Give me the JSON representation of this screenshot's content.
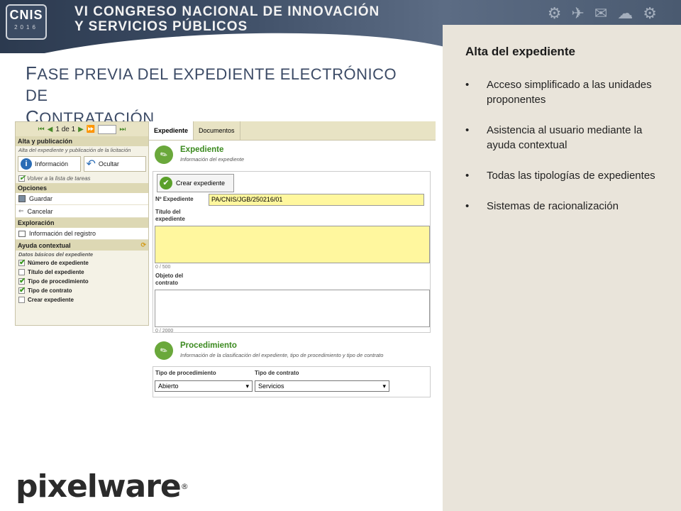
{
  "banner": {
    "logo_main": "CNIS",
    "logo_year": "2016",
    "title_line1": "VI CONGRESO NACIONAL DE INNOVACIÓN",
    "title_line2": "Y SERVICIOS PÚBLICOS"
  },
  "slide": {
    "title_f": "F",
    "title_rest1": "ASE PREVIA DEL EXPEDIENTE ELECTRÓNICO DE",
    "title_c": "C",
    "title_rest2": "ONTRATACIÓN"
  },
  "side": {
    "title": "Alta del expediente",
    "items": [
      "Acceso simplificado a las unidades proponentes",
      "Asistencia al usuario mediante la ayuda contextual",
      "Todas las tipologías de expedientes",
      "Sistemas de racionalización"
    ]
  },
  "app": {
    "pager": {
      "text": "1 de 1"
    },
    "left": {
      "section_title": "Alta y publicación",
      "section_sub": "Alta del expediente y publicación de la licitación",
      "info_btn": "Información",
      "hide_btn": "Ocultar",
      "back_link": "Volver a la lista de tareas",
      "options_head": "Opciones",
      "save": "Guardar",
      "cancel": "Cancelar",
      "explore_head": "Exploración",
      "record_info": "Información del registro",
      "help_head": "Ayuda contextual",
      "help_sub": "Datos básicos del expediente",
      "checklist": [
        {
          "label": "Número de expediente",
          "checked": true
        },
        {
          "label": "Título del expediente",
          "checked": false
        },
        {
          "label": "Tipo de procedimiento",
          "checked": true
        },
        {
          "label": "Tipo de contrato",
          "checked": true
        },
        {
          "label": "Crear expediente",
          "checked": false
        }
      ]
    },
    "tabs": [
      "Expediente",
      "Documentos"
    ],
    "expediente": {
      "title": "Expediente",
      "sub": "Información del expediente",
      "create_btn": "Crear expediente",
      "num_label": "Nº Expediente",
      "num_value": "PA/CNIS/JGB/250216/01",
      "title_label1": "Título del",
      "title_label2": "expediente",
      "title_count": "0 / 500",
      "object_label1": "Objeto del",
      "object_label2": "contrato",
      "object_count": "0 / 2000"
    },
    "procedimiento": {
      "title": "Procedimiento",
      "sub": "Información de la clasificación del expediente, tipo de procedimiento y tipo de contrato",
      "proc_label": "Tipo de procedimiento",
      "proc_value": "Abierto",
      "contract_label": "Tipo de contrato",
      "contract_value": "Servicios"
    }
  },
  "footer": {
    "logo": "pixelware",
    "reg": "®"
  }
}
